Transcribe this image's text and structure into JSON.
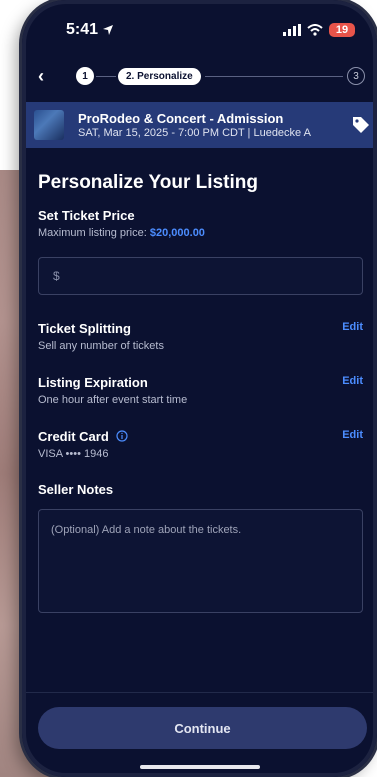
{
  "status": {
    "time": "5:41",
    "battery": "19"
  },
  "progress": {
    "step1": "1",
    "step2_label": "2. Personalize",
    "step3": "3"
  },
  "event": {
    "title": "ProRodeo & Concert - Admission",
    "subtitle": "SAT, Mar 15, 2025 - 7:00 PM CDT | Luedecke A"
  },
  "page": {
    "title": "Personalize Your Listing"
  },
  "price": {
    "label": "Set Ticket Price",
    "max_prefix": "Maximum listing price:",
    "max_value": "$20,000.00",
    "input_placeholder": "$"
  },
  "splitting": {
    "label": "Ticket Splitting",
    "value": "Sell any number of tickets",
    "edit": "Edit"
  },
  "expiration": {
    "label": "Listing Expiration",
    "value": "One hour after event start time",
    "edit": "Edit"
  },
  "card": {
    "label": "Credit Card",
    "value": "VISA •••• 1946",
    "edit": "Edit"
  },
  "notes": {
    "label": "Seller Notes",
    "placeholder": "(Optional) Add a note about the tickets."
  },
  "footer": {
    "continue": "Continue"
  },
  "colors": {
    "accent": "#4c8dff",
    "background": "#0b1130",
    "banner": "#263a78"
  }
}
